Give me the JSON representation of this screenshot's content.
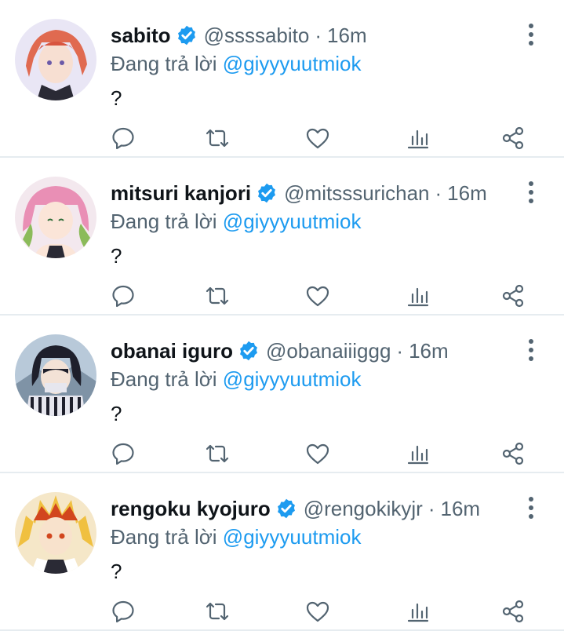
{
  "tweets": [
    {
      "name": "sabito",
      "handle": "@ssssabito",
      "separator": "·",
      "time": "16m",
      "reply_prefix": "Đang trả lời",
      "reply_to": "@giyyyuutmiok",
      "text": "?",
      "avatar_colors": [
        "#e9e6f5",
        "#e06a50",
        "#2a2a35"
      ]
    },
    {
      "name": "mitsuri kanjori",
      "handle": "@mitsssurichan",
      "separator": "·",
      "time": "16m",
      "reply_prefix": "Đang trả lời",
      "reply_to": "@giyyyuutmiok",
      "text": "?",
      "avatar_colors": [
        "#f3e8ee",
        "#e98fb5",
        "#8bbb5a"
      ]
    },
    {
      "name": "obanai iguro",
      "handle": "@obanaiiiggg",
      "separator": "·",
      "time": "16m",
      "reply_prefix": "Đang trả lời",
      "reply_to": "@giyyyuutmiok",
      "text": "?",
      "avatar_colors": [
        "#b8c9d9",
        "#1e1f2b",
        "#e6e6ee"
      ]
    },
    {
      "name": "rengoku kyojuro",
      "handle": "@rengokikyjr",
      "separator": "·",
      "time": "16m",
      "reply_prefix": "Đang trả lời",
      "reply_to": "@giyyyuutmiok",
      "text": "?",
      "avatar_colors": [
        "#f0c040",
        "#d2461e",
        "#f5e7c8"
      ]
    }
  ],
  "icons": {
    "verified": "verified-badge-icon",
    "more": "more-options-icon",
    "reply": "reply-icon",
    "retweet": "retweet-icon",
    "like": "like-icon",
    "stats": "stats-icon",
    "share": "share-icon"
  },
  "colors": {
    "accent": "#1d9bf0",
    "muted": "#536471",
    "divider": "#e6ecf0"
  }
}
